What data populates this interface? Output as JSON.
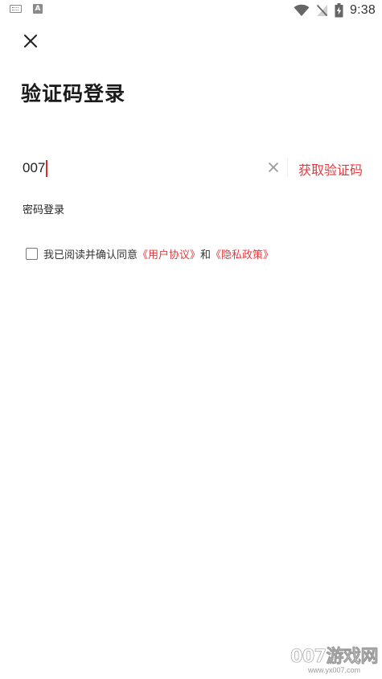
{
  "status_bar": {
    "time": "9:38",
    "left_icons": [
      "keyboard-icon",
      "a-icon"
    ],
    "right_icons": [
      "wifi-icon",
      "no-signal-icon",
      "battery-charging-icon"
    ],
    "a_icon_letter": "A"
  },
  "header": {
    "close_icon": "close-icon",
    "title": "验证码登录"
  },
  "phone_input": {
    "value": "007",
    "clear_icon": "clear-icon",
    "get_code_label": "获取验证码"
  },
  "password_login_label": "密码登录",
  "agreement": {
    "prefix": "我已阅读并确认同意",
    "user_agreement": "《用户协议》",
    "conjunction": "和",
    "privacy_policy": "《隐私政策》"
  },
  "watermark": {
    "text": "007游戏网",
    "url": "www.yx007.com"
  },
  "colors": {
    "accent": "#e8383d",
    "title": "#1a1a1a",
    "text": "#333333",
    "background": "#ffffff"
  }
}
